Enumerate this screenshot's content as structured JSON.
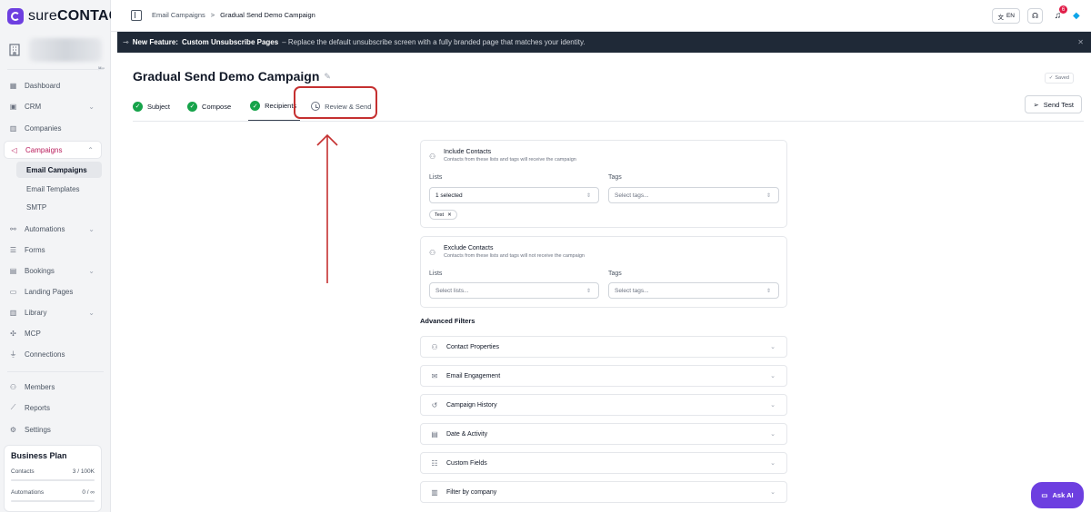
{
  "app": {
    "logo_pre": "sure",
    "logo_bold": "CONTACT"
  },
  "sidebar": {
    "items": [
      {
        "label": "Dashboard",
        "icon": "dashboard-icon"
      },
      {
        "label": "CRM",
        "icon": "crm-icon"
      },
      {
        "label": "Companies",
        "icon": "building-icon"
      },
      {
        "label": "Campaigns",
        "icon": "megaphone-icon"
      },
      {
        "label": "Automations",
        "icon": "workflow-icon"
      },
      {
        "label": "Forms",
        "icon": "form-icon"
      },
      {
        "label": "Bookings",
        "icon": "calendar-icon"
      },
      {
        "label": "Landing Pages",
        "icon": "layout-icon"
      },
      {
        "label": "Library",
        "icon": "library-icon"
      },
      {
        "label": "MCP",
        "icon": "mcp-icon"
      },
      {
        "label": "Connections",
        "icon": "plug-icon"
      },
      {
        "label": "Members",
        "icon": "members-icon"
      },
      {
        "label": "Reports",
        "icon": "chart-icon"
      },
      {
        "label": "Settings",
        "icon": "settings-icon"
      }
    ],
    "campaign_sub": [
      "Email Campaigns",
      "Email Templates",
      "SMTP"
    ],
    "plan": {
      "title": "Business Plan",
      "contacts_label": "Contacts",
      "contacts_value": "3 / 100K",
      "automations_label": "Automations",
      "automations_value": "0 / ∞"
    }
  },
  "topbar": {
    "breadcrumb_root": "Email Campaigns",
    "breadcrumb_sep": ">",
    "breadcrumb_current": "Gradual Send Demo Campaign",
    "lang": "EN",
    "notif_count": "6"
  },
  "banner": {
    "label": "New Feature:",
    "feature": "Custom Unsubscribe Pages",
    "text": "– Replace the default unsubscribe screen with a fully branded page that matches your identity."
  },
  "page": {
    "title": "Gradual Send Demo Campaign",
    "saved": "Saved",
    "send_test": "Send Test",
    "tabs": [
      {
        "label": "Subject",
        "state": "done"
      },
      {
        "label": "Compose",
        "state": "done"
      },
      {
        "label": "Recipients",
        "state": "current"
      },
      {
        "label": "Review & Send",
        "state": "pending"
      }
    ]
  },
  "include": {
    "title": "Include Contacts",
    "desc": "Contacts from these lists and tags will receive the campaign",
    "lists_label": "Lists",
    "lists_value": "1 selected",
    "tags_label": "Tags",
    "tags_placeholder": "Select tags...",
    "chip": "Test"
  },
  "exclude": {
    "title": "Exclude Contacts",
    "desc": "Contacts from these lists and tags will not receive the campaign",
    "lists_label": "Lists",
    "lists_placeholder": "Select lists...",
    "tags_label": "Tags",
    "tags_placeholder": "Select tags..."
  },
  "advanced": {
    "title": "Advanced Filters",
    "items": [
      {
        "label": "Contact Properties",
        "icon": "user-icon"
      },
      {
        "label": "Email Engagement",
        "icon": "mail-icon"
      },
      {
        "label": "Campaign History",
        "icon": "history-icon"
      },
      {
        "label": "Date & Activity",
        "icon": "calendar-icon"
      },
      {
        "label": "Custom Fields",
        "icon": "sliders-icon"
      },
      {
        "label": "Filter by company",
        "icon": "building-icon"
      }
    ]
  },
  "ask_ai": "Ask AI",
  "colors": {
    "brand": "#6d3fe0",
    "active_nav": "#b91c5c",
    "success": "#16a34a",
    "highlight": "#c53030"
  }
}
